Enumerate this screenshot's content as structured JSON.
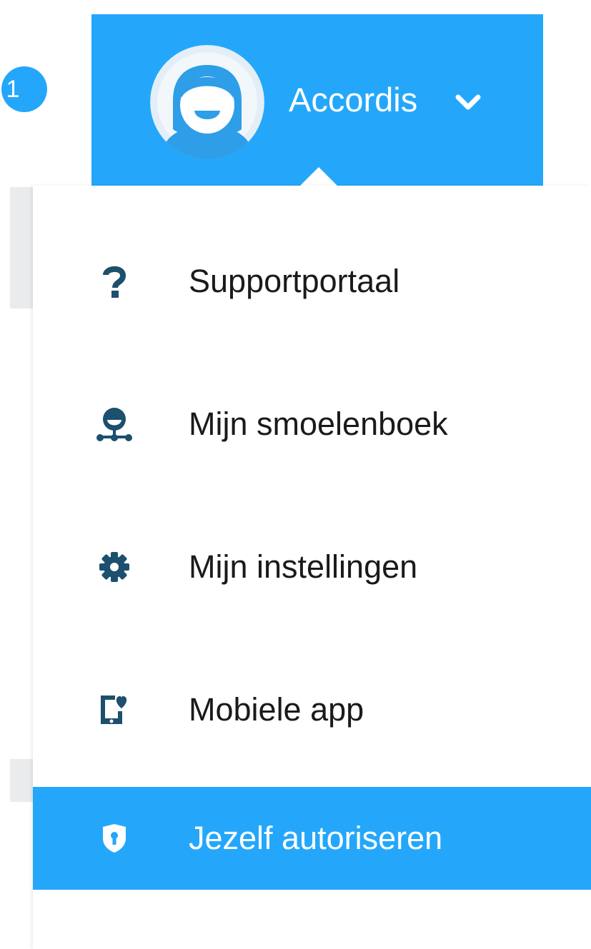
{
  "header": {
    "notification_count": "1",
    "user_name": "Accordis"
  },
  "menu": {
    "items": [
      {
        "label": "Supportportaal",
        "icon": "question-icon",
        "active": false
      },
      {
        "label": "Mijn smoelenboek",
        "icon": "org-chart-person-icon",
        "active": false
      },
      {
        "label": "Mijn instellingen",
        "icon": "gear-icon",
        "active": false
      },
      {
        "label": "Mobiele app",
        "icon": "mobile-heart-icon",
        "active": false
      },
      {
        "label": "Jezelf autoriseren",
        "icon": "shield-lock-icon",
        "active": true
      }
    ]
  },
  "colors": {
    "accent": "#24a7fa",
    "icon": "#1d4f6e",
    "text": "#1a1a1a"
  }
}
